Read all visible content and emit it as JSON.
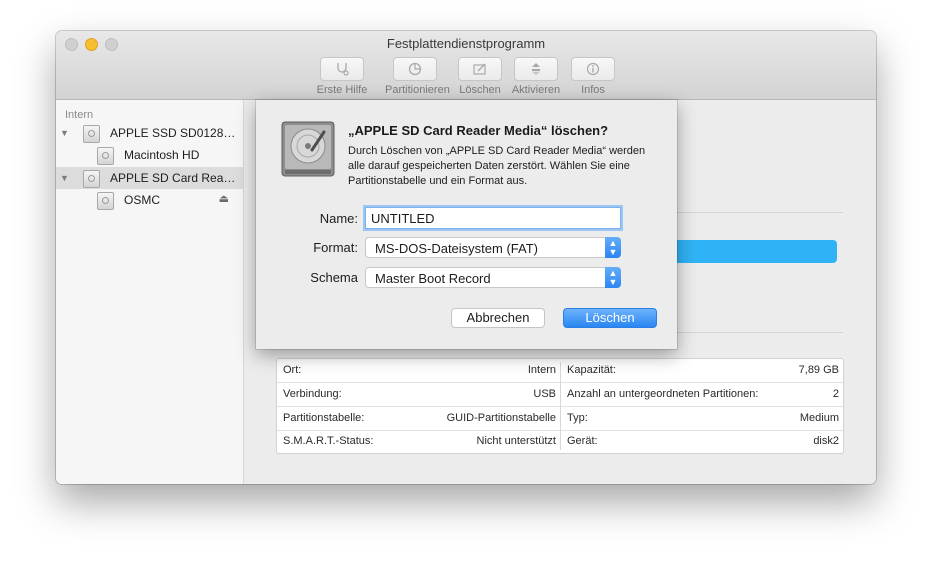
{
  "window": {
    "title": "Festplattendienstprogramm"
  },
  "toolbar": {
    "items": [
      {
        "label": "Erste Hilfe",
        "icon": "stethoscope-icon"
      },
      {
        "label": "Partitionieren",
        "icon": "pie-icon"
      },
      {
        "label": "Löschen",
        "icon": "erase-icon"
      },
      {
        "label": "Aktivieren",
        "icon": "mount-icon"
      },
      {
        "label": "Infos",
        "icon": "info-icon"
      }
    ]
  },
  "sidebar": {
    "heading": "Intern",
    "items": [
      {
        "label": "APPLE SSD SD0128…",
        "icon": "disk-icon"
      },
      {
        "label": "Macintosh HD",
        "icon": "volume-icon"
      },
      {
        "label": "APPLE SD Card Rea…",
        "icon": "disk-icon",
        "selected": true
      },
      {
        "label": "OSMC",
        "icon": "volume-icon",
        "eject": "⏏"
      }
    ]
  },
  "dialog": {
    "title": "„APPLE SD Card Reader Media“ löschen?",
    "message": "Durch Löschen von „APPLE SD Card Reader Media“ werden alle darauf gespeicherten Daten zerstört. Wählen Sie eine Partitionstabelle und ein Format aus.",
    "name_label": "Name:",
    "name_value": "UNTITLED",
    "format_label": "Format:",
    "format_value": "MS-DOS-Dateisystem (FAT)",
    "scheme_label": "Schema",
    "scheme_value": "Master Boot Record",
    "cancel_label": "Abbrechen",
    "confirm_label": "Löschen"
  },
  "info": {
    "left": [
      {
        "key": "Ort:",
        "value": "Intern"
      },
      {
        "key": "Verbindung:",
        "value": "USB"
      },
      {
        "key": "Partitionstabelle:",
        "value": "GUID-Partitionstabelle"
      },
      {
        "key": "S.M.A.R.T.-Status:",
        "value": "Nicht unterstützt"
      }
    ],
    "right": [
      {
        "key": "Kapazität:",
        "value": "7,89 GB"
      },
      {
        "key": "Anzahl an untergeordneten Partitionen:",
        "value": "2"
      },
      {
        "key": "Typ:",
        "value": "Medium"
      },
      {
        "key": "Gerät:",
        "value": "disk2"
      }
    ]
  },
  "colors": {
    "accent": "#2a86f3",
    "usage_bar": "#30b3f6"
  }
}
